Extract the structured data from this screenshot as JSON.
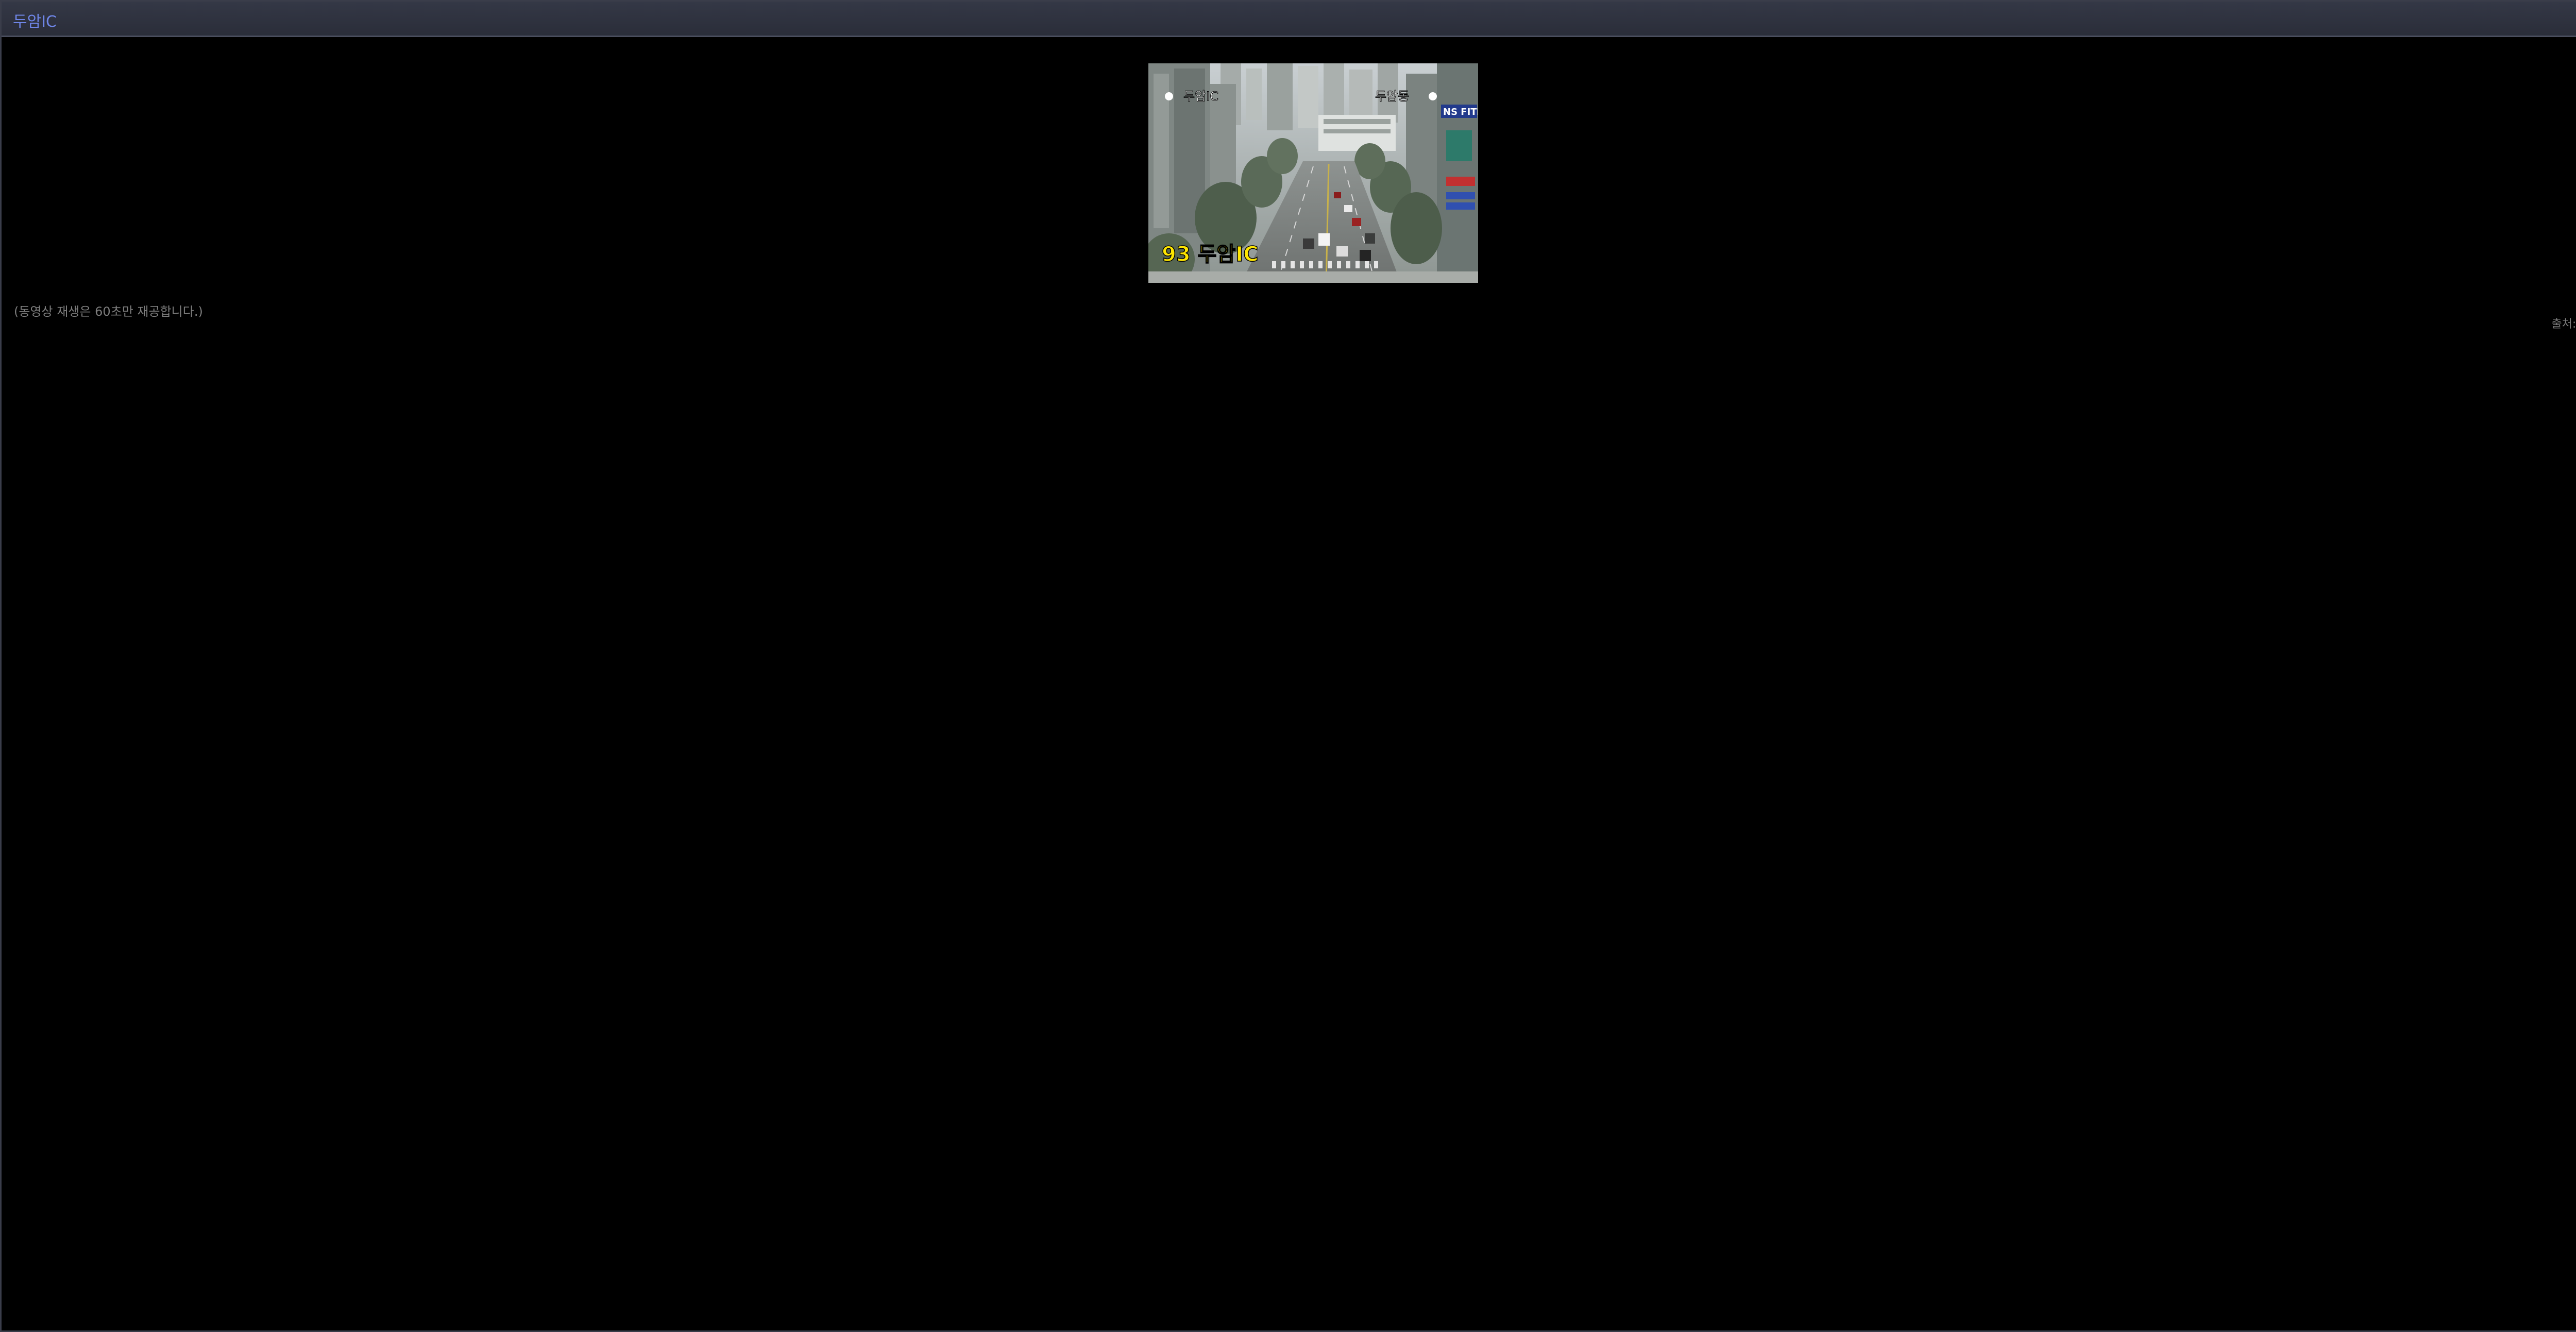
{
  "window": {
    "title": "두암IC",
    "close_icon": "close-icon"
  },
  "cctv": {
    "overlay_label_left": "두암IC",
    "overlay_label_right": "두암동",
    "caption": "93 두암IC",
    "sign_text": "NS FITNE"
  },
  "notice": "(동영상 재생은 60초만 재공합니다.)",
  "source": "출처:광역시",
  "colors": {
    "title": "#6f86e8",
    "titlebar": "#2e3140",
    "background": "#000000",
    "caption": "#ffe600",
    "muted_text": "#7d7d7d"
  }
}
